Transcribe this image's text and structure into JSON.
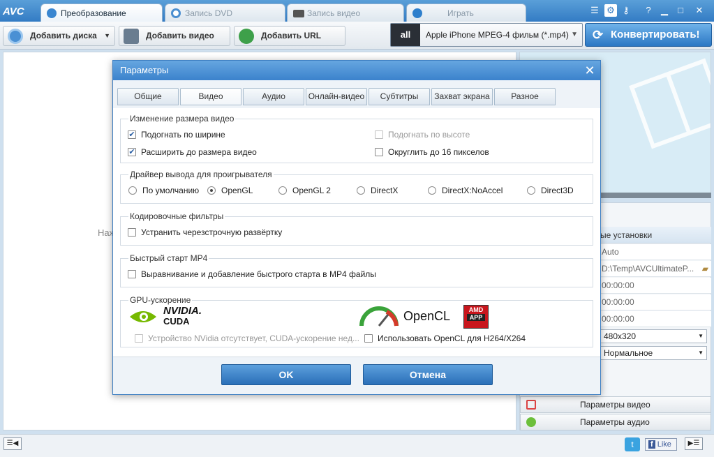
{
  "app": {
    "logo": "AVC",
    "tabs": [
      {
        "label": "Преобразование",
        "active": true
      },
      {
        "label": "Запись DVD",
        "active": false
      },
      {
        "label": "Запись видео",
        "active": false
      },
      {
        "label": "Играть",
        "active": false
      }
    ],
    "window_icons": [
      "list-icon",
      "gear-icon",
      "key-icon",
      "help-icon",
      "minimize-icon",
      "maximize-icon",
      "close-icon"
    ]
  },
  "toolbar": {
    "add_disc": "Добавить диска",
    "add_video": "Добавить видео",
    "add_url": "Добавить URL",
    "profile_icon_text": "all",
    "profile": "Apple iPhone MPEG-4 фильм (*.mp4)",
    "convert": "Конвертировать!"
  },
  "main": {
    "hint_fragment": "Наж"
  },
  "right_panel": {
    "section_label_fragment": "ые установки",
    "rows": [
      "Auto",
      "D:\\Temp\\AVCUltimateP...",
      "00:00:00",
      "00:00:00",
      "00:00:00"
    ],
    "resolution": "480x320",
    "quality": "Нормальное",
    "video_params": "Параметры видео",
    "audio_params": "Параметры аудио"
  },
  "statusbar": {
    "like": "Like"
  },
  "dialog": {
    "title": "Параметры",
    "tabs": [
      {
        "label": "Общие",
        "active": false
      },
      {
        "label": "Видео",
        "active": true
      },
      {
        "label": "Аудио",
        "active": false
      },
      {
        "label": "Онлайн-видео",
        "active": false
      },
      {
        "label": "Субтитры",
        "active": false
      },
      {
        "label": "Захват экрана",
        "active": false
      },
      {
        "label": "Разное",
        "active": false
      }
    ],
    "resize": {
      "title": "Изменение размера видео",
      "fit_width": {
        "label": "Подогнать по ширине",
        "checked": true
      },
      "fit_height": {
        "label": "Подогнать по высоте",
        "checked": false,
        "disabled": true
      },
      "expand": {
        "label": "Расширить до размера видео",
        "checked": true
      },
      "round16": {
        "label": "Округлить до 16 пикселов",
        "checked": false
      }
    },
    "driver": {
      "title": "Драйвер вывода для проигрывателя",
      "options": [
        "По умолчанию",
        "OpenGL",
        "OpenGL 2",
        "DirectX",
        "DirectX:NoAccel",
        "Direct3D"
      ],
      "selected": "OpenGL"
    },
    "filters": {
      "title": "Кодировочные фильтры",
      "deinterlace": {
        "label": "Устранить черезстрочную развёртку",
        "checked": false
      }
    },
    "mp4": {
      "title": "Быстрый старт MP4",
      "faststart": {
        "label": "Выравнивание и добавление быстрого старта в MP4 файлы",
        "checked": false
      }
    },
    "gpu": {
      "title": "GPU-ускорение",
      "nvidia_logo": "NVIDIA.",
      "cuda_logo": "CUDA",
      "opencl_logo": "OpenCL",
      "amd_logo": "AMD",
      "app_logo": "APP",
      "cuda_check": {
        "label": "Устройство NVidia отсутствует, CUDA-ускорение нед...",
        "checked": false,
        "disabled": true
      },
      "opencl_check": {
        "label": "Использовать OpenCL для H264/X264",
        "checked": false
      }
    },
    "ok": "OK",
    "cancel": "Отмена"
  },
  "colors": {
    "accent": "#2f78c2",
    "nvidia_green": "#76b900",
    "amd_red": "#c8161d"
  }
}
